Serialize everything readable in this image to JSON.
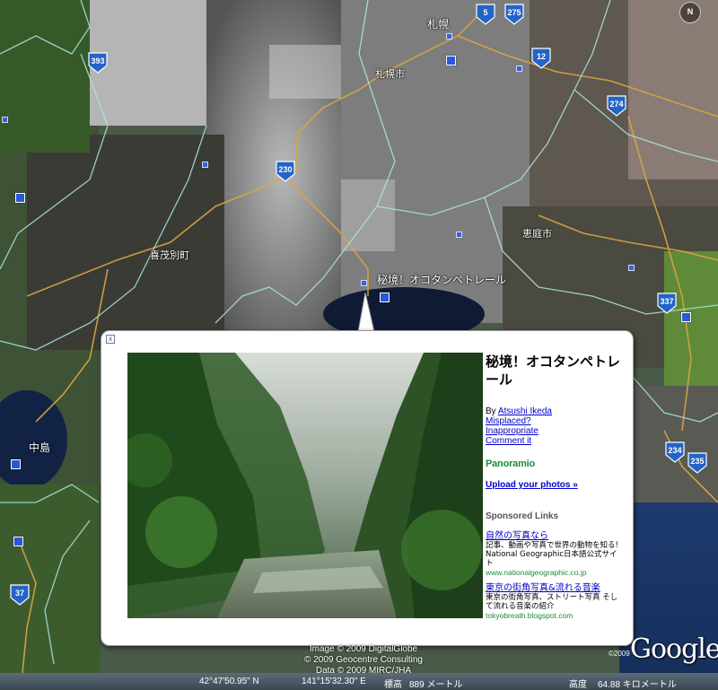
{
  "map": {
    "place_labels": [
      {
        "key": "sapporo_city",
        "text": "札幌市"
      },
      {
        "key": "sapporo",
        "text": "札幌"
      },
      {
        "key": "kimobetsu",
        "text": "喜茂別町"
      },
      {
        "key": "eniwa",
        "text": "恵庭市"
      },
      {
        "key": "nakajima",
        "text": "中島"
      },
      {
        "key": "marker",
        "text": "秘境！オコタンペトレール"
      }
    ],
    "route_shields": [
      "393",
      "230",
      "5",
      "275",
      "12",
      "274",
      "337",
      "234",
      "235",
      "37"
    ],
    "compass_label": "N"
  },
  "popup": {
    "close_label": "x",
    "title": "秘境！オコタンペトレール",
    "by_label": "By",
    "author": "Atsushi Ikeda",
    "links": [
      "Misplaced?",
      "Inappropriate",
      "Comment it"
    ],
    "brand": "Panoramio",
    "upload": "Upload your photos »",
    "sponsored_heading": "Sponsored Links",
    "ads": [
      {
        "title": "自然の写真なら",
        "text": "記事、動画や写真で世界の動物を知る! National Geographic日本語公式サイト",
        "url": "www.nationalgeographic.co.jp"
      },
      {
        "title": "東京の街角写真&流れる音楽",
        "text": "東京の街角写真、ストリート写真 そして流れる音楽の紹介",
        "url": "tokyobreath.blogspot.com"
      }
    ]
  },
  "attribution": {
    "line1": "Image © 2009 DigitalGlobe",
    "line2": "© 2009 Geocentre Consulting",
    "line3": "Data © 2009 MIRC/JHA"
  },
  "branding": {
    "copyright": "©2009",
    "logo": "Google"
  },
  "status": {
    "lat": "42°47'50.95\" N",
    "lon": "141°15'32.30\" E",
    "elev_label": "標高",
    "elev_value": "889 メートル",
    "alt_label": "高度",
    "alt_value": "64.88 キロメートル"
  }
}
